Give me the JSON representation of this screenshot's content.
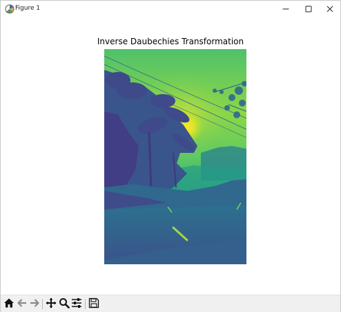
{
  "window": {
    "title": "Figure 1",
    "icons": {
      "app": "matplotlib-figure-icon",
      "minimize": "minimize-icon",
      "maximize": "maximize-icon",
      "close": "close-icon"
    }
  },
  "figure": {
    "title": "Inverse Daubechies Transformation",
    "image_colormap": "viridis"
  },
  "toolbar": {
    "buttons": [
      {
        "name": "home",
        "icon": "home-icon"
      },
      {
        "name": "back",
        "icon": "arrow-left-icon"
      },
      {
        "name": "forward",
        "icon": "arrow-right-icon"
      },
      {
        "name": "pan",
        "icon": "move-icon"
      },
      {
        "name": "zoom",
        "icon": "zoom-icon"
      },
      {
        "name": "configure-subplots",
        "icon": "sliders-icon"
      },
      {
        "name": "save",
        "icon": "save-icon"
      }
    ]
  },
  "colors": {
    "titlebar_bg": "#ffffff",
    "toolbar_bg": "#f0f0f0",
    "viridis_dark": "#3b528b",
    "viridis_mid": "#21918c",
    "viridis_light": "#5ec962",
    "viridis_bright": "#fde725"
  }
}
